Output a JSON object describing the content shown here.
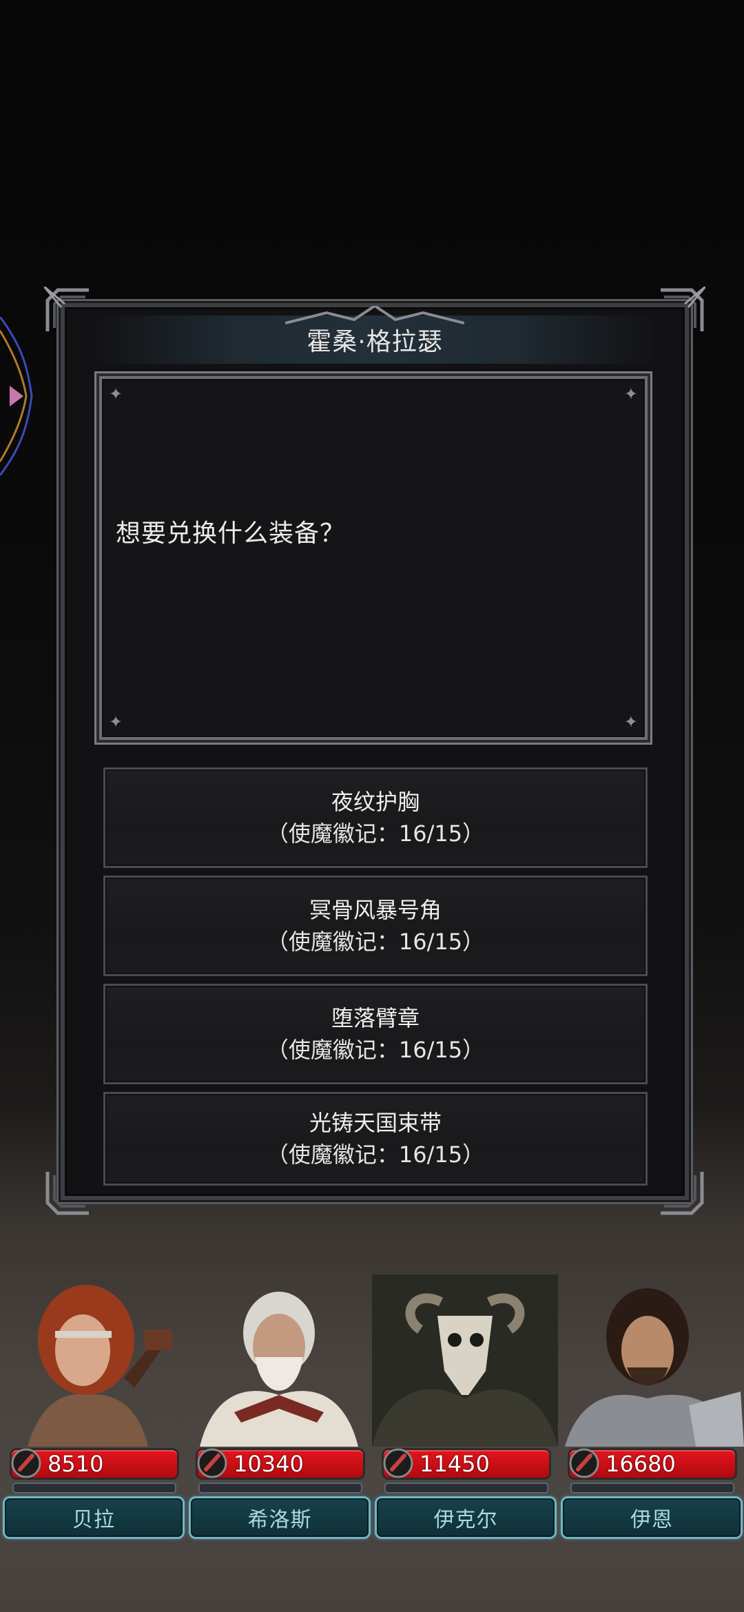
{
  "dialog": {
    "npc_name": "霍桑·格拉瑟",
    "message": "想要兑换什么装备？",
    "options": [
      {
        "name": "夜纹护胸",
        "cost": "（使魔徽记：16/15）"
      },
      {
        "name": "冥骨风暴号角",
        "cost": "（使魔徽记：16/15）"
      },
      {
        "name": "堕落臂章",
        "cost": "（使魔徽记：16/15）"
      },
      {
        "name": "光铸天国束带",
        "cost": "（使魔徽记：16/15）"
      }
    ]
  },
  "party": [
    {
      "name": "贝拉",
      "hp": "8510"
    },
    {
      "name": "希洛斯",
      "hp": "10340"
    },
    {
      "name": "伊克尔",
      "hp": "11450"
    },
    {
      "name": "伊恩",
      "hp": "16680"
    }
  ],
  "colors": {
    "hp_bar": "#d4121a",
    "name_plate_border": "#6fb6c6",
    "name_text": "#a9d9e3",
    "frame": "#3e3f44"
  }
}
